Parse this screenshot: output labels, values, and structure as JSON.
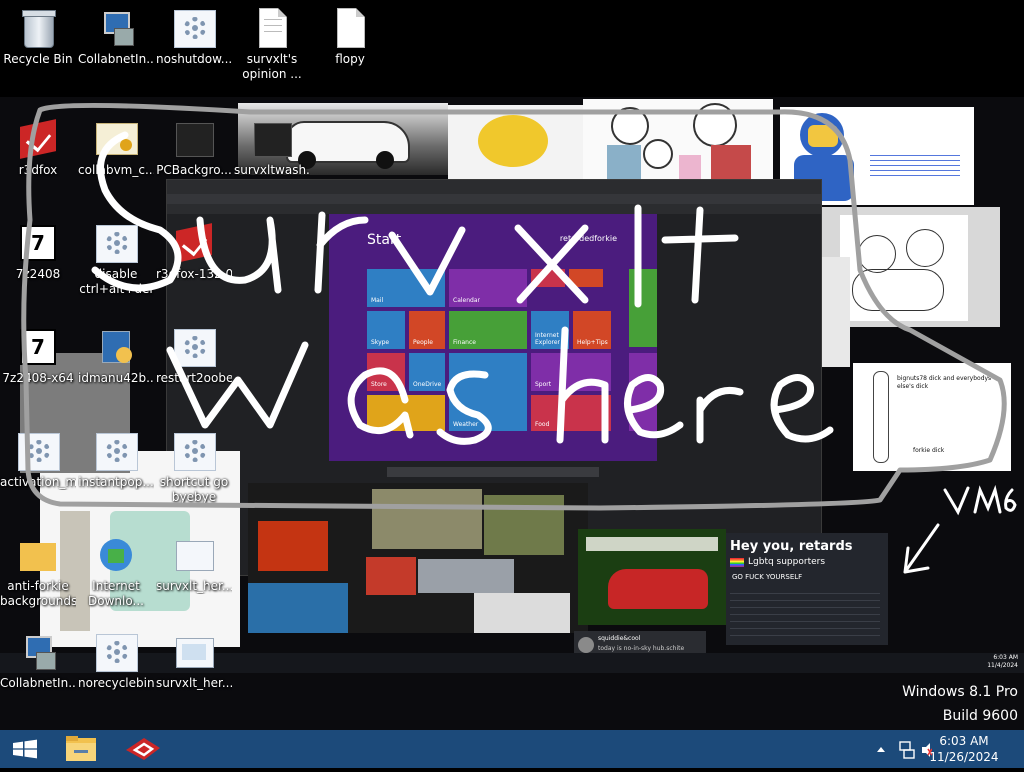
{
  "desktop": {
    "icons": [
      {
        "id": "recycle",
        "label": "Recycle Bin"
      },
      {
        "id": "collab1",
        "label": "CollabnetIn..."
      },
      {
        "id": "noshut",
        "label": "noshutdow..."
      },
      {
        "id": "opinion",
        "label": "survxlt's opinion ..."
      },
      {
        "id": "flopy",
        "label": "flopy"
      },
      {
        "id": "collab2",
        "label": "CollabnetIn..."
      },
      {
        "id": "norecycle",
        "label": "norecyclebin"
      },
      {
        "id": "survher",
        "label": "survxlt_her..."
      }
    ]
  },
  "wallpaper": {
    "icons": [
      {
        "label": "r3dfox"
      },
      {
        "label": "collabvm_c..."
      },
      {
        "label": "PCBackgro..."
      },
      {
        "label": "survxltwash..."
      },
      {
        "label": "7z2408"
      },
      {
        "label": "disable ctrl+alt+del"
      },
      {
        "label": "r3dfox-132.0..."
      },
      {
        "label": "7z2408-x64"
      },
      {
        "label": "idmanu42b..."
      },
      {
        "label": "restart2oobe"
      },
      {
        "label": "activation_ma..."
      },
      {
        "label": "instantpop..."
      },
      {
        "label": "shortcut go byebye"
      },
      {
        "label": "anti-forkie backgrounds"
      },
      {
        "label": "Internet Downlo..."
      },
      {
        "label": "survxlt_her..."
      }
    ],
    "start_label": "Start",
    "start_user": "retardedforkie",
    "drawn_text": "survxlt was here",
    "vm_tag": "VM6",
    "note_bignuts": "bignuts78 dick and everybodys else's dick",
    "note_forkie": "forkie dick",
    "ad_title": "Hey you, retards",
    "ad_subtitle": "Lgbtq supporters",
    "ad_line": "GO FUCK YOURSELF",
    "tile_labels": [
      "Mail",
      "Calendar",
      "Skype",
      "People",
      "Finance",
      "Internet Explorer",
      "Help+Tips",
      "Store",
      "OneDrive",
      "Weather",
      "Sport",
      "Food"
    ],
    "chat_user": "squiddie&cool",
    "chat_text": "today is no-in-sky hub.schite posting",
    "mini_time": "6:03 AM",
    "mini_date": "11/4/2024"
  },
  "os_watermark": {
    "edition": "Windows 8.1 Pro",
    "build": "Build 9600"
  },
  "taskbar": {
    "start": "start-button",
    "pinned": [
      "file-explorer",
      "r3dfox-browser"
    ],
    "time": "6:03 AM",
    "date": "11/26/2024"
  },
  "colors": {
    "taskbar": "#1c4a7a",
    "metro_bg": "#4b1c7e",
    "tile_blue": "#2f7fc4",
    "tile_green": "#47a038",
    "tile_red": "#c9334b",
    "tile_purple": "#7f2ea8"
  }
}
